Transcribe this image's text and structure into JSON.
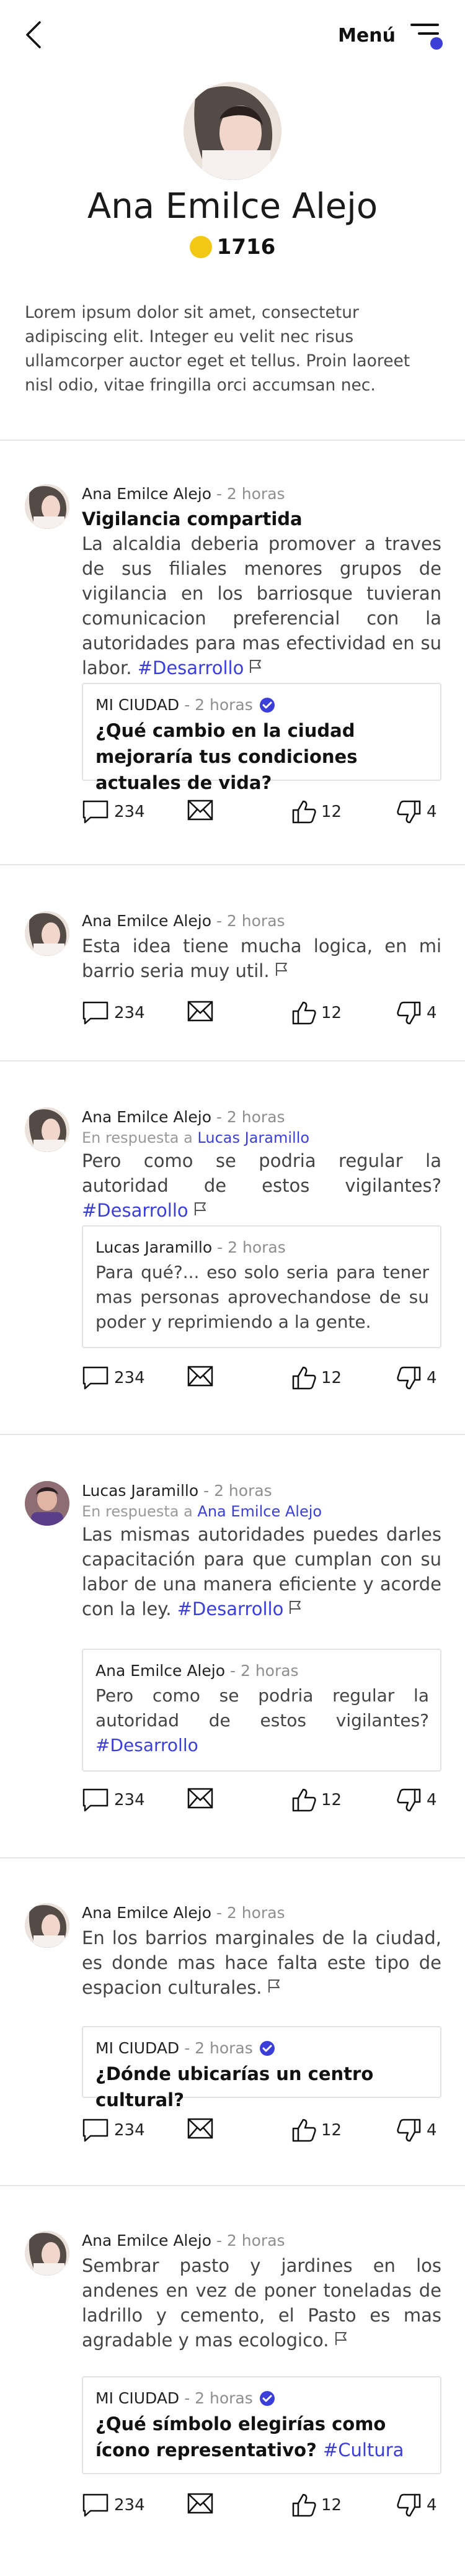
{
  "header": {
    "menu_label": "Menú"
  },
  "profile": {
    "name": "Ana Emilce Alejo",
    "points": "1716",
    "bio": "Lorem ipsum dolor sit amet, consectetur adipiscing elit. Integer eu velit nec risus ullamcorper auctor eget et tellus. Proin laoreet nisl odio, vitae fringilla orci accumsan nec."
  },
  "colors": {
    "accent": "#3b3fd8",
    "coin": "#f3c814"
  },
  "posts": [
    {
      "author": "Ana Emilce Alejo",
      "time": "- 2 horas",
      "title": "Vigilancia compartida",
      "text": "La alcaldia deberia promover a traves de sus filiales menores grupos de vigilancia en los barriosque tuvieran comunicacion preferencial con la autoridades para mas efectividad en su labor.",
      "tag": "#Desarrollo",
      "quote": {
        "author": "MI CIUDAD",
        "time": "- 2 horas",
        "verified": true,
        "title": "¿Qué cambio en la ciudad mejoraría tus condiciones actuales de vida?"
      },
      "comments": "234",
      "likes": "12",
      "dislikes": "4"
    },
    {
      "author": "Ana Emilce Alejo",
      "time": "- 2 horas",
      "text": "Esta idea tiene mucha logica, en mi barrio seria muy util.",
      "comments": "234",
      "likes": "12",
      "dislikes": "4"
    },
    {
      "author": "Ana Emilce Alejo",
      "time": "- 2 horas",
      "reply_prefix": "En respuesta a",
      "reply_to": "Lucas Jaramillo",
      "text": "Pero como se podria regular la autoridad de estos vigilantes?",
      "tag": "#Desarrollo",
      "quote": {
        "author": "Lucas Jaramillo",
        "time": "- 2 horas",
        "text": "Para qué?... eso solo seria para tener mas personas aprovechandose de su poder y reprimiendo a la gente."
      },
      "comments": "234",
      "likes": "12",
      "dislikes": "4"
    },
    {
      "author": "Lucas Jaramillo",
      "time": "- 2 horas",
      "reply_prefix": "En respuesta a",
      "reply_to": "Ana Emilce Alejo",
      "text": "Las mismas autoridades puedes darles capacitación para que cumplan con su labor de una manera eficiente y acorde con la ley.",
      "tag": "#Desarrollo",
      "quote": {
        "author": "Ana Emilce Alejo",
        "time": "- 2 horas",
        "text": "Pero como se podria regular la autoridad de estos vigilantes?",
        "tag": "#Desarrollo"
      },
      "comments": "234",
      "likes": "12",
      "dislikes": "4"
    },
    {
      "author": "Ana Emilce Alejo",
      "time": "- 2 horas",
      "text": "En los barrios marginales de la ciudad, es donde mas hace falta este tipo de espacion culturales.",
      "quote": {
        "author": "MI CIUDAD",
        "time": "- 2 horas",
        "verified": true,
        "title": "¿Dónde ubicarías un centro cultural?"
      },
      "comments": "234",
      "likes": "12",
      "dislikes": "4"
    },
    {
      "author": "Ana Emilce Alejo",
      "time": "- 2 horas",
      "text": "Sembrar pasto y jardines en los andenes en vez de poner toneladas de ladrillo y cemento, el Pasto es mas agradable y mas ecologico.",
      "quote": {
        "author": "MI CIUDAD",
        "time": "- 2 horas",
        "verified": true,
        "title": "¿Qué símbolo elegirías como ícono representativo?",
        "tag": "#Cultura"
      },
      "comments": "234",
      "likes": "12",
      "dislikes": "4"
    }
  ]
}
